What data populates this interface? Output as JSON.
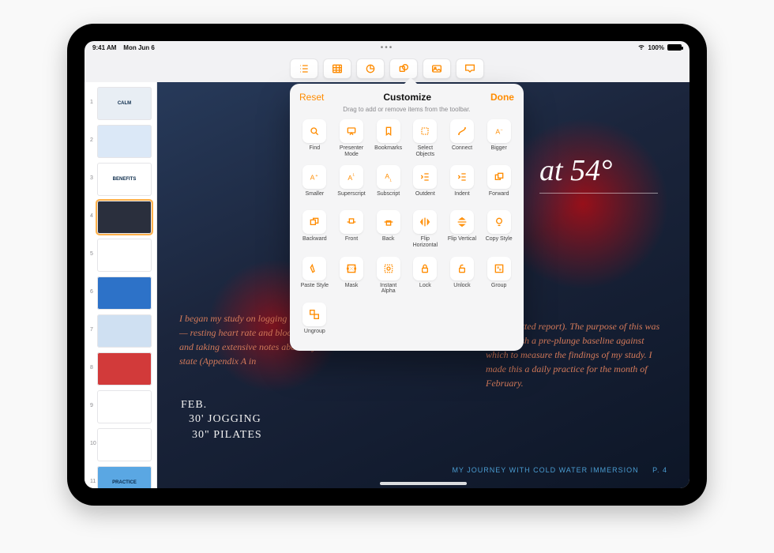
{
  "status": {
    "time": "9:41 AM",
    "date": "Mon Jun 6",
    "battery": "100%"
  },
  "multitask_dots": "•••",
  "toolbar": [
    {
      "name": "outline-icon"
    },
    {
      "name": "table-icon"
    },
    {
      "name": "chart-icon"
    },
    {
      "name": "shapes-icon"
    },
    {
      "name": "media-icon"
    },
    {
      "name": "comment-icon"
    }
  ],
  "navigator": {
    "slides": [
      {
        "n": "1",
        "label": "CALM",
        "cls": "tA"
      },
      {
        "n": "2",
        "label": "",
        "cls": "tB"
      },
      {
        "n": "3",
        "label": "BENEFITS",
        "cls": "tC"
      },
      {
        "n": "4",
        "label": "",
        "cls": "tD",
        "selected": true
      },
      {
        "n": "5",
        "label": "",
        "cls": "tE"
      },
      {
        "n": "6",
        "label": "",
        "cls": "tF"
      },
      {
        "n": "7",
        "label": "",
        "cls": "tG"
      },
      {
        "n": "8",
        "label": "",
        "cls": "tH"
      },
      {
        "n": "9",
        "label": "",
        "cls": "tI"
      },
      {
        "n": "10",
        "label": "",
        "cls": "tJ"
      },
      {
        "n": "11",
        "label": "PRACTICE",
        "cls": "tK"
      }
    ],
    "add_glyph": "+"
  },
  "slide": {
    "temp": "54°",
    "para_left": "I began my study on\nlogging biometric data — resting heart\nrate and blood pressure; and taking extensive\nnotes about my mental state (Appendix A in",
    "para_right": "my submitted report). The purpose of this was to establish a pre-plunge baseline against which to measure the findings of my study. I made this a daily practice for the month of February.",
    "hand1": "FEB.",
    "hand2": "30' JOGGING",
    "hand3": "30\" PILATES",
    "footer_label": "MY JOURNEY WITH COLD WATER IMMERSION",
    "footer_page": "P. 4"
  },
  "popover": {
    "reset": "Reset",
    "title": "Customize",
    "done": "Done",
    "subtitle": "Drag to add or remove items from the toolbar.",
    "items": [
      {
        "label": "Find",
        "icon": "search"
      },
      {
        "label": "Presenter\nMode",
        "icon": "presenter"
      },
      {
        "label": "Bookmarks",
        "icon": "bookmark"
      },
      {
        "label": "Select\nObjects",
        "icon": "select"
      },
      {
        "label": "Connect",
        "icon": "connect"
      },
      {
        "label": "Bigger",
        "icon": "bigger"
      },
      {
        "label": "Smaller",
        "icon": "smaller"
      },
      {
        "label": "Superscript",
        "icon": "super"
      },
      {
        "label": "Subscript",
        "icon": "sub"
      },
      {
        "label": "Outdent",
        "icon": "outdent"
      },
      {
        "label": "Indent",
        "icon": "indent"
      },
      {
        "label": "Forward",
        "icon": "forward"
      },
      {
        "label": "Backward",
        "icon": "backward"
      },
      {
        "label": "Front",
        "icon": "front"
      },
      {
        "label": "Back",
        "icon": "back"
      },
      {
        "label": "Flip\nHorizontal",
        "icon": "fliph"
      },
      {
        "label": "Flip Vertical",
        "icon": "flipv"
      },
      {
        "label": "Copy Style",
        "icon": "copystyle"
      },
      {
        "label": "Paste Style",
        "icon": "pastestyle"
      },
      {
        "label": "Mask",
        "icon": "mask"
      },
      {
        "label": "Instant\nAlpha",
        "icon": "alpha"
      },
      {
        "label": "Lock",
        "icon": "lock"
      },
      {
        "label": "Unlock",
        "icon": "unlock"
      },
      {
        "label": "Group",
        "icon": "group"
      },
      {
        "label": "Ungroup",
        "icon": "ungroup"
      }
    ]
  }
}
